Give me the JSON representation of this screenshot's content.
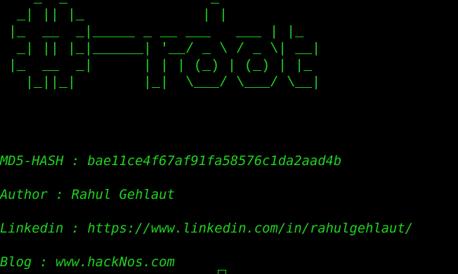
{
  "terminal": {
    "banner_lines": [
      "    _  _                 _",
      "  _| || |_              | |",
      " |_  __  _|_____ _ __ ___   ___ | |_",
      "  _| || |_|______| '__/ _ \\ / _ \\| __|",
      " |_  __  _|      | | | (_) | (_) | |_",
      "   |_||_|        |_|  \\___/ \\___/ \\__|"
    ],
    "info": {
      "md5": "MD5-HASH : bae11ce4f67af91fa58576c1da2aad4b",
      "author": "Author : Rahul Gehlaut",
      "linkedin": "Linkedin : https://www.linkedin.com/in/rahulgehlaut/",
      "blog": "Blog : www.hackNos.com"
    },
    "text_color": "#1fd31f",
    "background_color": "#000000"
  }
}
